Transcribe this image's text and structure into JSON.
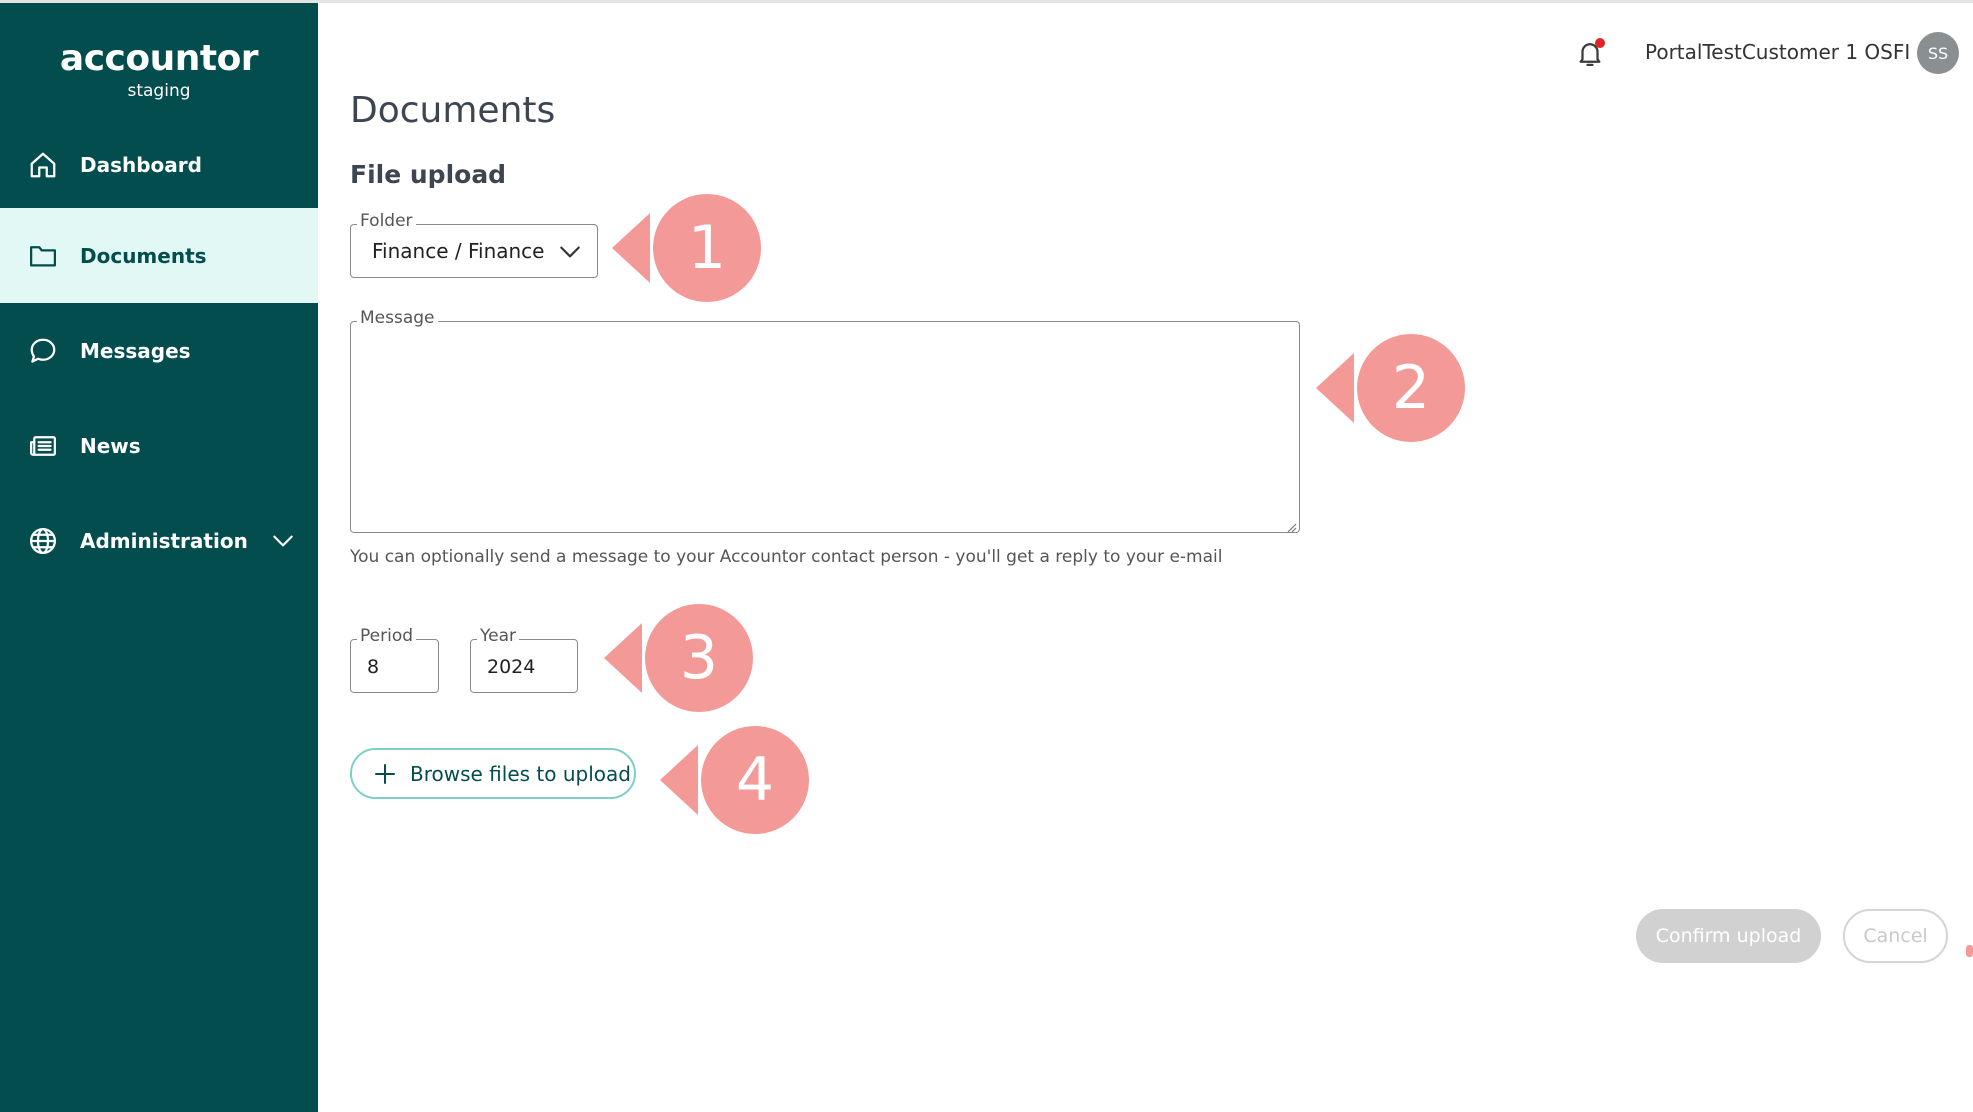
{
  "brand": {
    "logo_text": "accountor",
    "environment": "staging"
  },
  "sidebar": {
    "items": [
      {
        "label": "Dashboard",
        "icon": "home-icon",
        "active": false
      },
      {
        "label": "Documents",
        "icon": "folder-icon",
        "active": true
      },
      {
        "label": "Messages",
        "icon": "chat-bubble-icon",
        "active": false
      },
      {
        "label": "News",
        "icon": "newspaper-icon",
        "active": false
      },
      {
        "label": "Administration",
        "icon": "globe-icon",
        "active": false,
        "expandable": true
      }
    ]
  },
  "header": {
    "notification_icon": "bell-icon",
    "has_notification": true,
    "user_name": "PortalTestCustomer 1 OSFI",
    "avatar_initials": "SS"
  },
  "main": {
    "title": "Documents",
    "section_title": "File upload",
    "folder": {
      "label": "Folder",
      "value": "Finance / Finance"
    },
    "message": {
      "label": "Message",
      "value": ""
    },
    "message_helper": "You can optionally send a message to your Accountor contact person - you'll get a reply to your e-mail",
    "period": {
      "label": "Period",
      "value": "8"
    },
    "year": {
      "label": "Year",
      "value": "2024"
    },
    "browse_button": "Browse files to upload",
    "confirm_button": "Confirm upload",
    "cancel_button": "Cancel"
  },
  "callouts": [
    "1",
    "2",
    "3",
    "4"
  ],
  "colors": {
    "sidebar_bg": "#034d4e",
    "active_item_bg": "#e2f8f4",
    "accent_outline": "#7dcfc8",
    "callout": "#f39a98",
    "notification_dot": "#e32228",
    "disabled_button": "#d1d1d1"
  }
}
